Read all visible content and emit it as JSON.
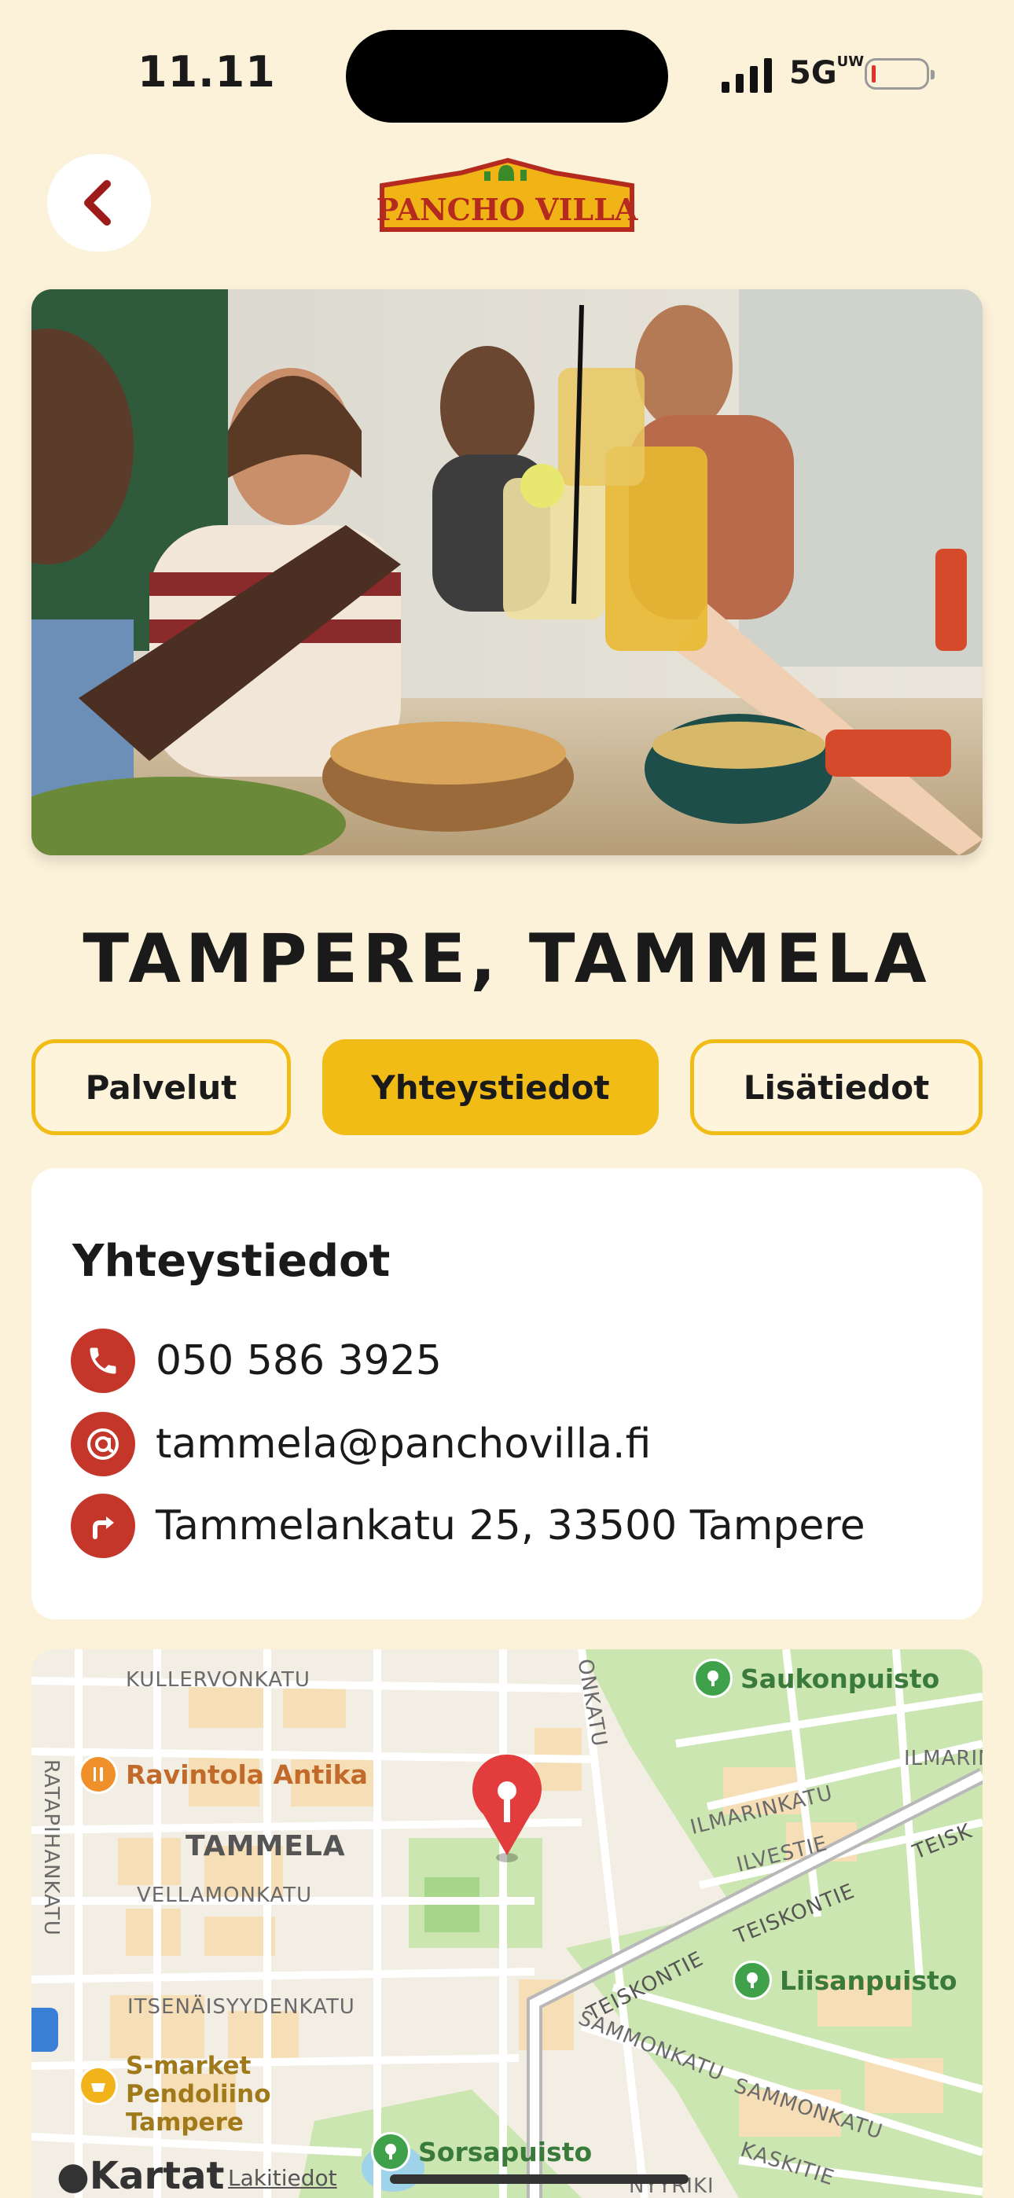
{
  "status": {
    "time": "11.11",
    "network": "5G",
    "network_sup": "UW"
  },
  "header": {
    "logo_text": "PANCHO VILLA"
  },
  "restaurant": {
    "title": "TAMPERE, TAMMELA"
  },
  "tabs": [
    {
      "label": "Palvelut",
      "active": false
    },
    {
      "label": "Yhteystiedot",
      "active": true
    },
    {
      "label": "Lisätiedot",
      "active": false
    }
  ],
  "contact": {
    "heading": "Yhteystiedot",
    "phone": "050 586 3925",
    "email": "tammela@panchovilla.fi",
    "address": "Tammelankatu 25, 33500 Tampere"
  },
  "map": {
    "streets": {
      "kullervonkatu": "KULLERVONKATU",
      "onkatu": "ONKATU",
      "ratapihankatu": "RATAPIHANKATU",
      "vellamonkatu": "VELLAMONKATU",
      "itsenaisyydenkatu": "ITSENÄISYYDENKATU",
      "ilmarinkatu": "ILMARINKATU",
      "ilmarink": "ILMARINK",
      "ilvestie": "ILVESTIE",
      "teiskontie1": "TEISKONTIE",
      "teiskontie2": "TEISKONTIE",
      "teisk": "TEISK",
      "sammonkatu1": "SAMMONKATU",
      "sammonkatu2": "SAMMONKATU",
      "kaskitie": "KASKITIE",
      "nyyrik": "NYYRIKI"
    },
    "district": "TAMMELA",
    "pois": {
      "saukonpuisto": "Saukonpuisto",
      "ravintola": "Ravintola Antika",
      "liisanpuisto": "Liisanpuisto",
      "smarket": "S-market\nPendoliino\nTampere",
      "sorsapuisto": "Sorsapuisto"
    },
    "attribution": "Kartat",
    "legal": "Lakitiedot"
  },
  "colors": {
    "accent": "#f2bc17",
    "brand_red": "#c4362a",
    "background": "#fcf1d9"
  }
}
